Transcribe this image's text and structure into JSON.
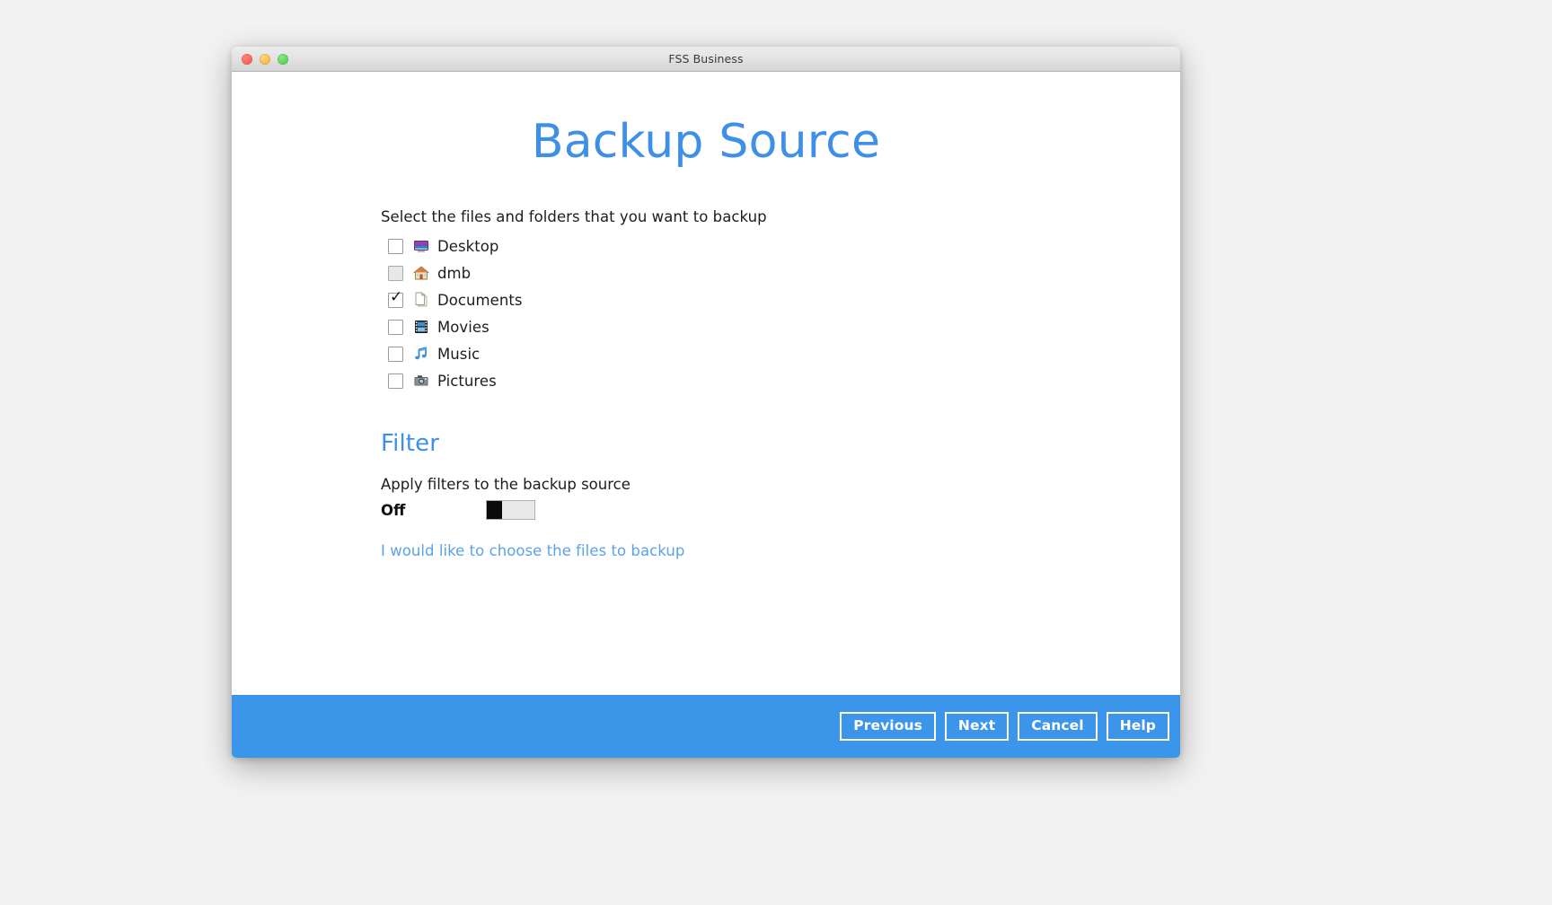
{
  "window": {
    "title": "FSS Business",
    "traffic_lights": [
      {
        "name": "close-button",
        "color": "#f2584c"
      },
      {
        "name": "minimize-button",
        "color": "#f2b02c"
      },
      {
        "name": "maximize-button",
        "color": "#45c845"
      }
    ]
  },
  "page": {
    "title": "Backup Source",
    "title_color": "#3d8fe8"
  },
  "source": {
    "instruction": "Select the files and folders that you want to backup",
    "items": [
      {
        "label": "Desktop",
        "icon": "desktop-icon",
        "checked": false,
        "disabled": false
      },
      {
        "label": "dmb",
        "icon": "home-icon",
        "checked": false,
        "disabled": true
      },
      {
        "label": "Documents",
        "icon": "document-icon",
        "checked": true,
        "disabled": false
      },
      {
        "label": "Movies",
        "icon": "film-icon",
        "checked": false,
        "disabled": false
      },
      {
        "label": "Music",
        "icon": "music-note-icon",
        "checked": false,
        "disabled": false
      },
      {
        "label": "Pictures",
        "icon": "camera-icon",
        "checked": false,
        "disabled": false
      }
    ]
  },
  "filter": {
    "heading": "Filter",
    "description": "Apply filters to the backup source",
    "toggle_state": "Off",
    "toggle_on": false,
    "choose_link": "I would like to choose the files to backup",
    "link_color": "#5aa2ea"
  },
  "footer": {
    "background": "#3b95e8",
    "buttons": [
      {
        "label": "Previous",
        "name": "previous-button"
      },
      {
        "label": "Next",
        "name": "next-button"
      },
      {
        "label": "Cancel",
        "name": "cancel-button"
      },
      {
        "label": "Help",
        "name": "help-button"
      }
    ]
  }
}
